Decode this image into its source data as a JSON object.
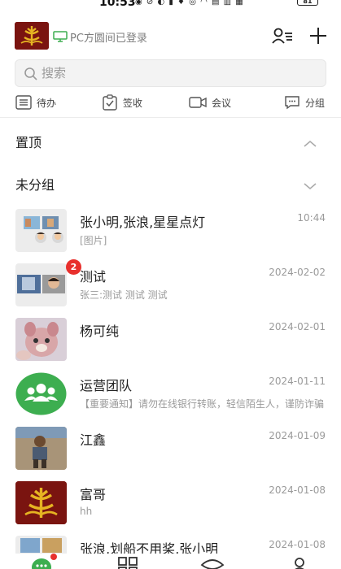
{
  "status_bar": {
    "time": "10:53",
    "icons": "◉ ⊘ ◐ ▮ ♦ ◎ ◠ ▤ ▥ ▦",
    "battery": "81"
  },
  "header": {
    "pc_status": "PC方圆间已登录",
    "contacts_icon": "contacts-icon",
    "plus_icon": "plus-icon"
  },
  "search": {
    "placeholder": "搜索",
    "value": ""
  },
  "toolbar": {
    "items": [
      {
        "label": "待办",
        "icon": "todo-list-icon"
      },
      {
        "label": "签收",
        "icon": "clipboard-check-icon"
      },
      {
        "label": "会议",
        "icon": "video-camera-icon"
      },
      {
        "label": "分组",
        "icon": "chat-group-icon"
      }
    ]
  },
  "groups": [
    {
      "label": "置顶",
      "icon": "chevron-up-icon"
    },
    {
      "label": "未分组",
      "icon": "chevron-down-icon"
    }
  ],
  "chats": [
    {
      "name": "张小明,张浪,星星点灯",
      "preview": "[图片]",
      "date": "10:44"
    },
    {
      "name": "测试",
      "preview": "张三:测试 测试 测试",
      "date": "2024-02-02",
      "badge": "2"
    },
    {
      "name": "杨可纯",
      "preview": "",
      "date": "2024-02-01"
    },
    {
      "name": "运营团队",
      "preview": "【重要通知】请勿在线银行转账，轻信陌生人，谨防诈骗",
      "date": "2024-01-11"
    },
    {
      "name": "江鑫",
      "preview": "",
      "date": "2024-01-09"
    },
    {
      "name": "富哥",
      "preview": "hh",
      "date": "2024-01-08"
    },
    {
      "name": "张浪,划船不用桨,张小明",
      "preview": "",
      "date": "2024-01-08"
    }
  ],
  "colors": {
    "accent_green": "#3dae50",
    "badge_red": "#e8302d",
    "logo_bg": "#7a1410",
    "logo_gold": "#e6b422"
  }
}
